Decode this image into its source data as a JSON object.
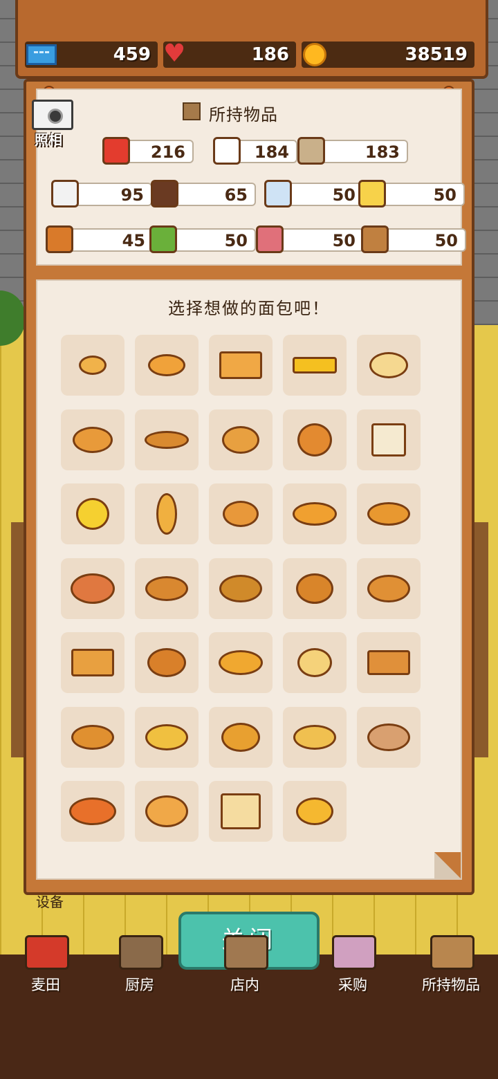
{
  "resources": {
    "tickets": "459",
    "hearts": "186",
    "coins": "38519"
  },
  "camera": {
    "label": "照相"
  },
  "inventory": {
    "title": "所持物品",
    "items": [
      {
        "icon": "flour-bag-icon",
        "count": "216",
        "color": "#e33c2e"
      },
      {
        "icon": "milk-bottle-icon",
        "count": "184",
        "color": "#ffffff"
      },
      {
        "icon": "eggs-icon",
        "count": "183",
        "color": "#c9b08a"
      },
      {
        "icon": "sugar-jar-icon",
        "count": "95",
        "color": "#f2f2f2"
      },
      {
        "icon": "chocolate-icon",
        "count": "65",
        "color": "#6a3a22"
      },
      {
        "icon": "salt-icon",
        "count": "50",
        "color": "#cfe3f5"
      },
      {
        "icon": "cheese-icon",
        "count": "50",
        "color": "#f7d24a"
      },
      {
        "icon": "fruit-basket-icon",
        "count": "45",
        "color": "#d97a2a"
      },
      {
        "icon": "vegetable-basket-icon",
        "count": "50",
        "color": "#6ab03a"
      },
      {
        "icon": "ham-icon",
        "count": "50",
        "color": "#e0707a"
      },
      {
        "icon": "spices-icon",
        "count": "50",
        "color": "#c08040"
      }
    ]
  },
  "bread_selection": {
    "title": "选择想做的面包吧！",
    "breads": [
      {
        "icon": "small-roll-icon",
        "color": "#f0b24a"
      },
      {
        "icon": "round-bun-icon",
        "color": "#f0a23a"
      },
      {
        "icon": "loaf-icon",
        "color": "#f0a845"
      },
      {
        "icon": "egg-toast-icon",
        "color": "#f5c020"
      },
      {
        "icon": "donut-icon",
        "color": "#f5d890"
      },
      {
        "icon": "bagel-icon",
        "color": "#e89a3a"
      },
      {
        "icon": "croissant-icon",
        "color": "#d98a30"
      },
      {
        "icon": "melon-pan-icon",
        "color": "#e8a040"
      },
      {
        "icon": "bunny-bread-icon",
        "color": "#e38a30"
      },
      {
        "icon": "sandwich-icon",
        "color": "#f5ead0"
      },
      {
        "icon": "cream-bun-icon",
        "color": "#f5d030"
      },
      {
        "icon": "baguette-icon",
        "color": "#f0b040"
      },
      {
        "icon": "sprinkle-donut-icon",
        "color": "#e8983a"
      },
      {
        "icon": "pretzel-icon",
        "color": "#f0a030"
      },
      {
        "icon": "boule-icon",
        "color": "#e89830"
      },
      {
        "icon": "jam-danish-icon",
        "color": "#e07840"
      },
      {
        "icon": "choco-cornet-icon",
        "color": "#d98830"
      },
      {
        "icon": "herb-bread-icon",
        "color": "#d08a2a"
      },
      {
        "icon": "bear-bread-icon",
        "color": "#d9852a"
      },
      {
        "icon": "choco-roll-icon",
        "color": "#e09035"
      },
      {
        "icon": "cake-slice-icon",
        "color": "#e8a040"
      },
      {
        "icon": "apple-pie-icon",
        "color": "#d9802a"
      },
      {
        "icon": "curry-bread-icon",
        "color": "#f0a830"
      },
      {
        "icon": "burger-icon",
        "color": "#f5d27a"
      },
      {
        "icon": "waffle-icon",
        "color": "#e0903a"
      },
      {
        "icon": "oval-loaf-icon",
        "color": "#e09030"
      },
      {
        "icon": "cheese-bun-icon",
        "color": "#f0c040"
      },
      {
        "icon": "cream-pan-icon",
        "color": "#e8a030"
      },
      {
        "icon": "pineapple-bun-icon",
        "color": "#f0c050"
      },
      {
        "icon": "country-loaf-icon",
        "color": "#d9a070"
      },
      {
        "icon": "pizza-bread-icon",
        "color": "#e8702a"
      },
      {
        "icon": "brioche-icon",
        "color": "#f0a848"
      },
      {
        "icon": "toast-slices-icon",
        "color": "#f5dca0"
      },
      {
        "icon": "chick-bun-icon",
        "color": "#f5b830"
      }
    ]
  },
  "close_button": {
    "label": "关闭"
  },
  "bottom_nav": [
    {
      "label": "麦田",
      "icon": "wheat-field-icon"
    },
    {
      "label": "厨房",
      "icon": "kitchen-icon"
    },
    {
      "label": "店内",
      "icon": "store-icon"
    },
    {
      "label": "采购",
      "icon": "shopping-icon"
    },
    {
      "label": "所持物品",
      "icon": "inventory-box-icon"
    }
  ],
  "background": {
    "equipment_label": "设备"
  }
}
